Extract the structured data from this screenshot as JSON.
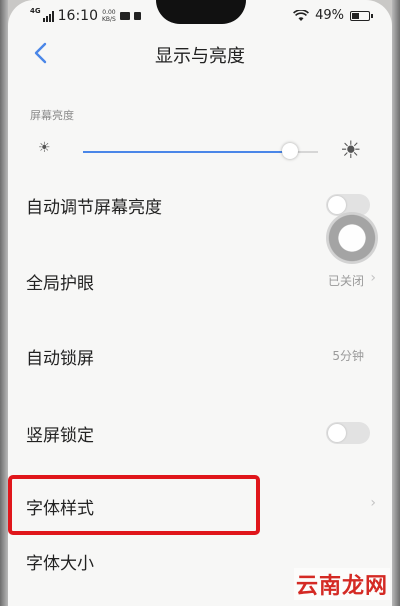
{
  "status_bar": {
    "network": "4G",
    "time": "16:10",
    "speed_value": "0.00",
    "speed_unit": "KB/S",
    "battery_percent": "49%",
    "battery_level": 0.49
  },
  "header": {
    "title": "显示与亮度"
  },
  "brightness": {
    "section_label": "屏幕亮度",
    "level": 0.88
  },
  "settings": [
    {
      "label": "自动调节屏幕亮度",
      "control": "toggle",
      "on": false
    },
    {
      "label": "全局护眼",
      "control": "value",
      "value": "已关闭"
    },
    {
      "label": "自动锁屏",
      "control": "value",
      "value": "5分钟"
    },
    {
      "label": "竖屏锁定",
      "control": "toggle",
      "on": false
    },
    {
      "label": "字体样式",
      "control": "chevron"
    },
    {
      "label": "字体大小",
      "control": "chevron"
    }
  ],
  "watermark": "云南龙网",
  "colors": {
    "accent": "#4a86e8",
    "highlight": "#e0161b",
    "watermark": "#d42a24"
  }
}
